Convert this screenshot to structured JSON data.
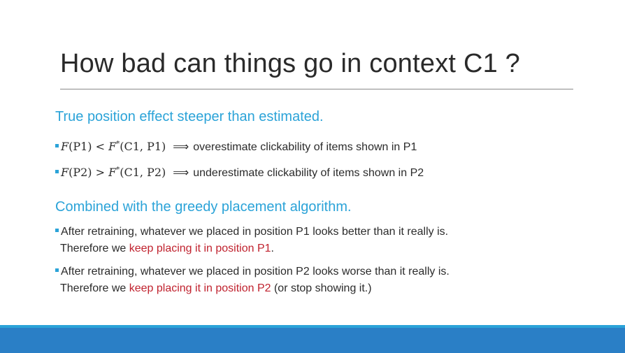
{
  "slide": {
    "title": "How bad can things go in context C1 ?",
    "section1": {
      "heading": "True position effect steeper than estimated.",
      "bullets": [
        {
          "lhs_func": "F",
          "lhs_arg": "(P1)",
          "op": "<",
          "rhs_func": "F",
          "rhs_sup": "*",
          "rhs_arg": "(C1, P1)",
          "arrow": "⟹",
          "text": "overestimate clickability of items shown in P1"
        },
        {
          "lhs_func": "F",
          "lhs_arg": "(P2)",
          "op": ">",
          "rhs_func": "F",
          "rhs_sup": "*",
          "rhs_arg": "(C1, P2)",
          "arrow": "⟹",
          "text": "underestimate clickability of items shown in P2"
        }
      ]
    },
    "section2": {
      "heading": "Combined with the greedy placement algorithm.",
      "items": [
        {
          "line1": "After retraining, whatever we placed in position P1 looks better than it really is.",
          "line2_prefix": "Therefore we ",
          "line2_highlight": "keep placing it in position P1",
          "line2_suffix": "."
        },
        {
          "line1": "After retraining, whatever we placed in position P2 looks worse than it really is.",
          "line2_prefix": "Therefore we ",
          "line2_highlight": "keep placing it in position P2",
          "line2_suffix": " (or stop showing it.)"
        }
      ]
    }
  },
  "colors": {
    "heading": "#2ba3d8",
    "highlight": "#c0222e",
    "footer_thin": "#2ba3d8",
    "footer_bar": "#2a7fc6"
  }
}
